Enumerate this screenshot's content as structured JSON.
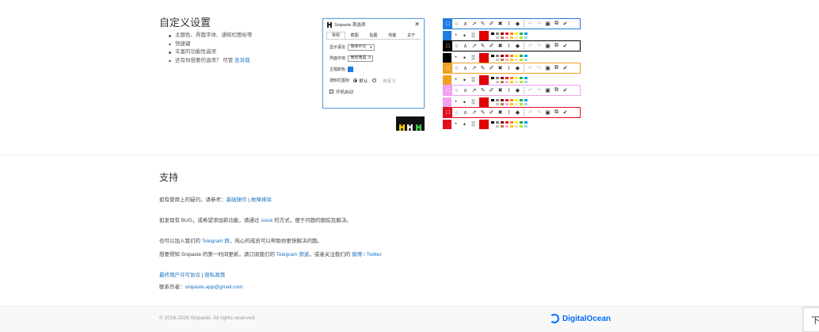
{
  "custom": {
    "title": "自定义设置",
    "features": [
      "主题色、界面字体、通知栏图标等",
      "快捷键",
      "丰富的功能性选项",
      "还有你想要的选项？ 尽管 "
    ],
    "tell_us_link": "告诉我"
  },
  "prefs_dialog": {
    "title": "Snipaste 首选项",
    "tabs": [
      "常规",
      "截图",
      "贴图",
      "热键",
      "关于"
    ],
    "language_label": "显示语言:",
    "language_value": "简体中文",
    "font_label": "界面字体:",
    "font_value": "微软雅黑, 9",
    "theme_label": "主题颜色:",
    "tray_label": "通知栏图标:",
    "tray_default": "默认",
    "tray_custom": "自定义",
    "autostart_label": "开机启动",
    "theme_color": "#1e7ce0"
  },
  "toolbars": {
    "theme_colors": [
      "#1e7ce0",
      "#000000",
      "#f0a020",
      "#f0a0f0",
      "#e01020"
    ],
    "palette": [
      "#000000",
      "#7f7f7f",
      "#880015",
      "#ed1c24",
      "#ff7f27",
      "#fff200",
      "#22b14c",
      "#00a2e8",
      "#ffffff",
      "#c3c3c3",
      "#b97a57",
      "#ffaec9",
      "#ffc90e",
      "#efe4b0",
      "#b5e61d",
      "#99d9ea"
    ],
    "selected_color": "#e00000"
  },
  "support": {
    "title": "支持",
    "p1_text": "如有使用上的疑问，请参考：",
    "p1_link1": "基础操作",
    "p1_sep": " | ",
    "p1_link2": "故障排除",
    "p2_text": "如发现有 BUG，或希望添加新功能，请通过 ",
    "p2_link": "issue",
    "p2_tail": " 的方式，便于问题的跟踪及解决。",
    "p3_text": "也可以加入我们的 ",
    "p3_link": "Telegram 群",
    "p3_tail": "，热心的成员可以帮助你更快解决问题。",
    "p4_text": "想要得知 Snipaste 的第一时间更新，请订阅我们的 ",
    "p4_link1": "Telegram 频道",
    "p4_mid": "，或者关注我们的 ",
    "p4_link2": "微博",
    "p4_sep": " / ",
    "p4_link3": "Twitter",
    "eula_link": "最终用户许可协议",
    "eula_sep": " | ",
    "privacy_link": "隐私政策",
    "contact_label": "联系作者：",
    "contact_email": "snipaste.app@gmail.com"
  },
  "footer": {
    "copyright": "© 2016-2026 Snipaste. All rights reserved.",
    "sponsor": "DigitalOcean",
    "down_button": "下"
  }
}
